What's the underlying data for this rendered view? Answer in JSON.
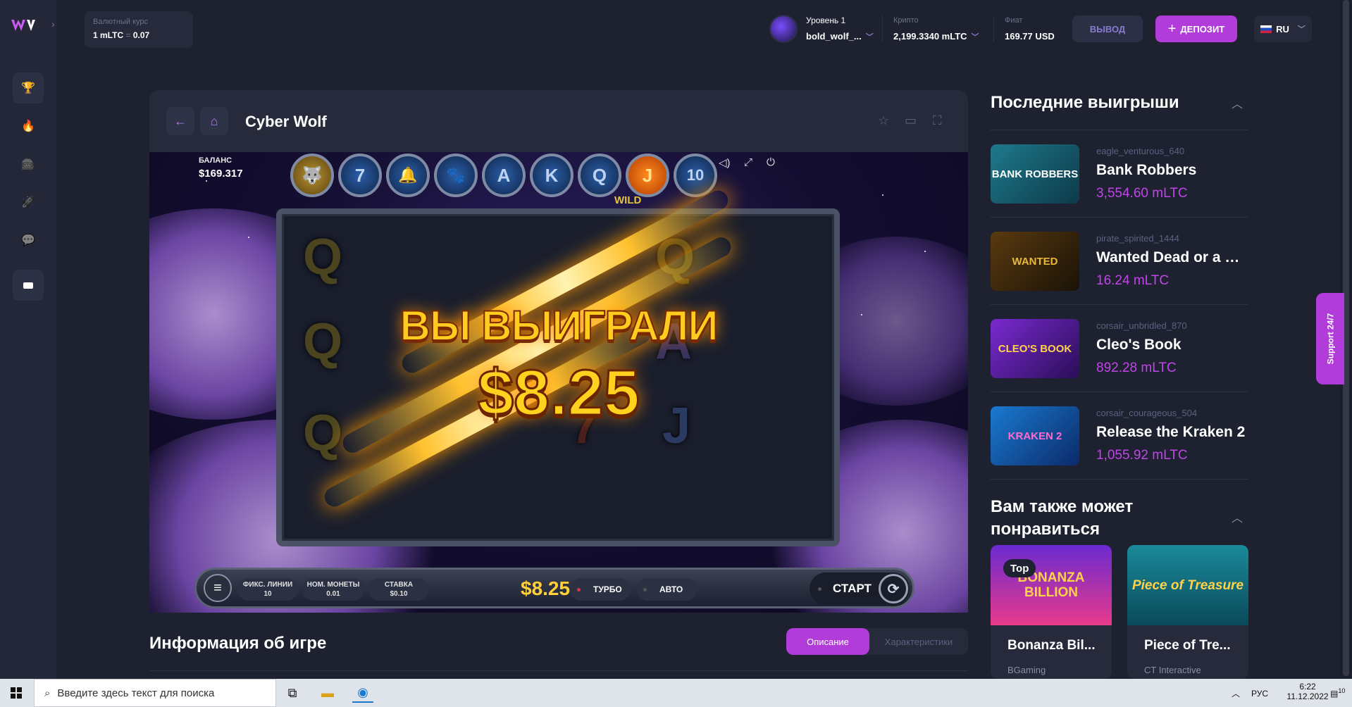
{
  "header": {
    "rate_label": "Валютный курс",
    "rate_value": "1 mLTC",
    "rate_sep": "=",
    "rate_result": "0.07",
    "level": "Уровень 1",
    "username": "bold_wolf_...",
    "crypto_label": "Крипто",
    "crypto_value": "2,199.3340 mLTC",
    "fiat_label": "Фиат",
    "fiat_value": "169.77 USD",
    "withdraw": "ВЫВОД",
    "deposit": "ДЕПОЗИТ",
    "lang": "RU"
  },
  "sidebar": {
    "items": [
      {
        "name": "trophy-icon",
        "glyph": "🏆"
      },
      {
        "name": "fire-icon",
        "glyph": "🔥"
      },
      {
        "name": "slots-icon",
        "glyph": "🎰"
      },
      {
        "name": "rocket-icon",
        "glyph": "🚀"
      },
      {
        "name": "chat-icon",
        "glyph": "💬"
      }
    ]
  },
  "game": {
    "title": "Cyber Wolf",
    "balance_label": "БАЛАНС",
    "balance_value": "$169.317",
    "top_symbols": [
      "🐺",
      "7",
      "🔔",
      "🐾",
      "A",
      "K",
      "Q",
      "J",
      "10"
    ],
    "wild_label": "WILD",
    "win_title": "ВЫ ВЫИГРАЛИ",
    "win_amount": "$8.25",
    "lines_label": "ФИКС. ЛИНИИ",
    "lines_value": "10",
    "coin_label": "НОМ. МОНЕТЫ",
    "coin_value": "0.01",
    "stake_label": "СТАВКА",
    "stake_value": "$0.10",
    "bet_display": "$8.25",
    "turbo": "ТУРБО",
    "auto": "АВТО",
    "start": "СТАРТ"
  },
  "info": {
    "title": "Информация об игре",
    "tab_active": "Описание",
    "tab_inactive": "Характеристики"
  },
  "recent": {
    "title": "Последние выигрыши",
    "items": [
      {
        "user": "eagle_venturous_640",
        "game": "Bank Robbers",
        "amount": "3,554.60 mLTC",
        "thumb": "BANK ROBBERS"
      },
      {
        "user": "pirate_spirited_1444",
        "game": "Wanted Dead or a Wil...",
        "amount": "16.24 mLTC",
        "thumb": "WANTED"
      },
      {
        "user": "corsair_unbridled_870",
        "game": "Cleo's Book",
        "amount": "892.28 mLTC",
        "thumb": "CLEO'S BOOK"
      },
      {
        "user": "corsair_courageous_504",
        "game": "Release the Kraken 2",
        "amount": "1,055.92 mLTC",
        "thumb": "KRAKEN 2"
      }
    ]
  },
  "recommend": {
    "title": "Вам также может понравиться",
    "items": [
      {
        "name": "Bonanza Bil...",
        "provider": "BGaming",
        "badge": "Top",
        "img": "BONANZA BILLION"
      },
      {
        "name": "Piece of Tre...",
        "provider": "CT Interactive",
        "img": "Piece of Treasure"
      }
    ]
  },
  "support": "Support 24/7",
  "taskbar": {
    "search_placeholder": "Введите здесь текст для поиска",
    "lang": "РУС",
    "time": "6:22",
    "date": "11.12.2022",
    "notif": "10"
  },
  "colors": {
    "accent": "#b23cd9",
    "bg": "#1e2130",
    "panel": "#262a3b",
    "win": "#c046e8"
  }
}
